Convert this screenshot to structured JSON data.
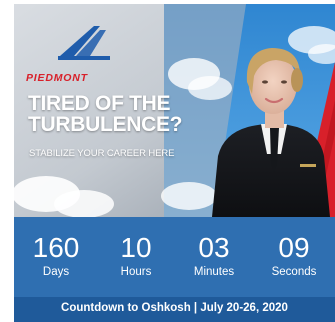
{
  "brand": {
    "name": "PIEDMONT",
    "accent_color": "#d8202a",
    "logo_color": "#1f5cab"
  },
  "hero": {
    "headline_line1": "TIRED OF THE",
    "headline_line2": "TURBULENCE?",
    "tagline": "STABILIZE YOUR CAREER HERE",
    "image_subject": "pilot-portrait"
  },
  "countdown": {
    "units": [
      {
        "value": "160",
        "label": "Days"
      },
      {
        "value": "10",
        "label": "Hours"
      },
      {
        "value": "03",
        "label": "Minutes"
      },
      {
        "value": "09",
        "label": "Seconds"
      }
    ],
    "background_color": "#2f6fb1"
  },
  "footer": {
    "text": "Countdown to Oshkosh | July 20-26, 2020",
    "background_color": "#1f5a9a"
  }
}
